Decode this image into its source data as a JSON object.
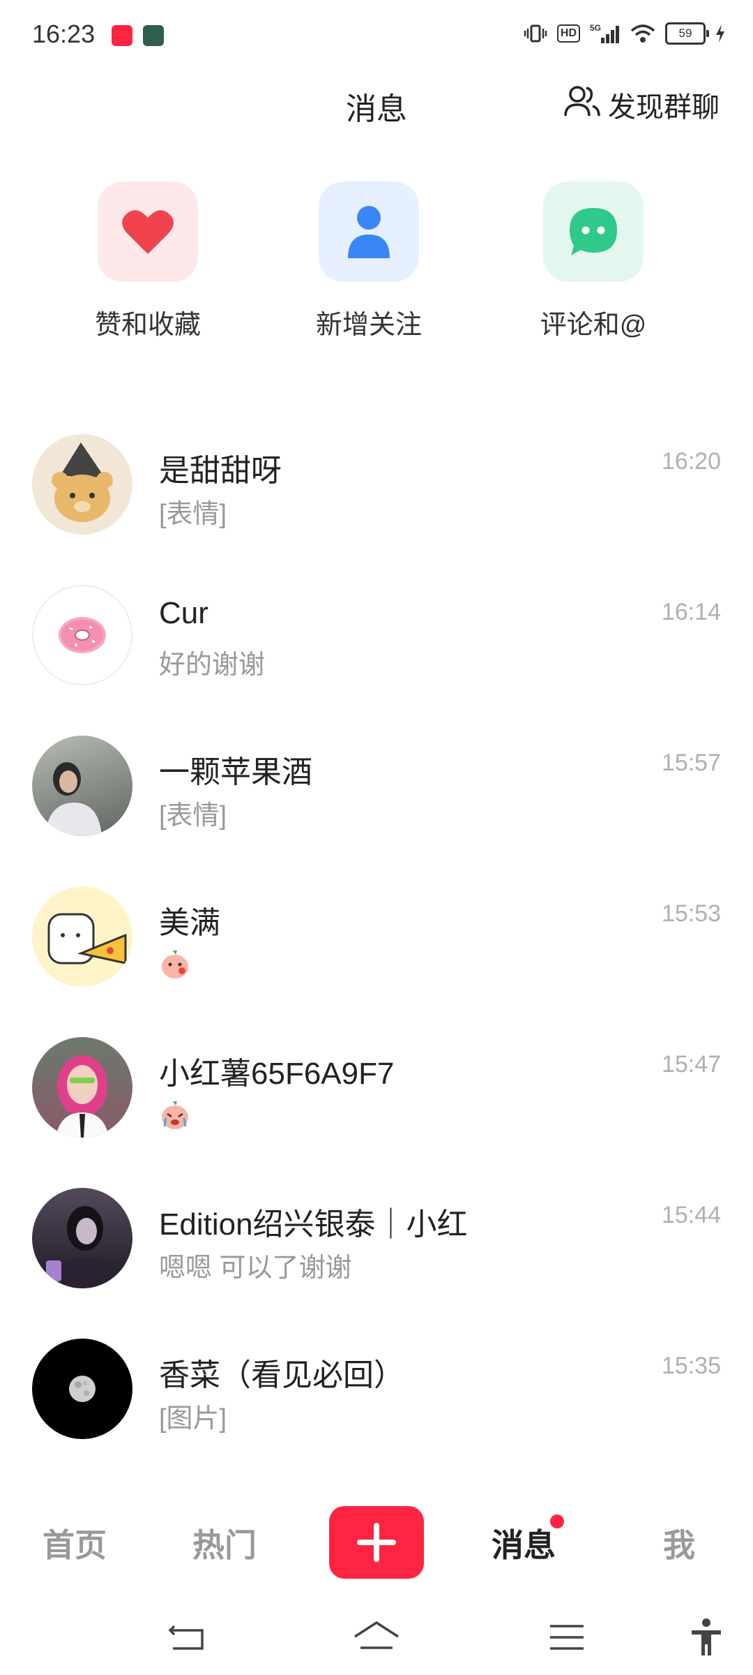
{
  "status_bar": {
    "time": "16:23",
    "network": "5G",
    "hd": "HD",
    "battery": "59"
  },
  "header": {
    "title": "消息",
    "group_chat_label": "发现群聊"
  },
  "quick_actions": [
    {
      "label": "赞和收藏",
      "icon": "heart-icon",
      "color": "#f0434e",
      "bg": "#fde9e9"
    },
    {
      "label": "新增关注",
      "icon": "person-icon",
      "color": "#3b86f5",
      "bg": "#e6f0ff"
    },
    {
      "label": "评论和@",
      "icon": "chat-bubble-icon",
      "color": "#2fc98b",
      "bg": "#e4f7ee"
    }
  ],
  "messages": [
    {
      "name": "是甜甜呀",
      "preview": "[表情]",
      "time": "16:20",
      "avatar_bg": "#f2e6d6"
    },
    {
      "name": "Cur",
      "preview": "好的谢谢",
      "time": "16:14",
      "avatar_bg": "#ffffff"
    },
    {
      "name": "一颗苹果酒",
      "preview": "[表情]",
      "time": "15:57",
      "avatar_bg": "#8a8f88"
    },
    {
      "name": "美满",
      "preview": "",
      "time": "15:53",
      "avatar_bg": "#fff4c9"
    },
    {
      "name": "小红薯65F6A9F7",
      "preview": "",
      "time": "15:47",
      "avatar_bg": "#8a5a6a"
    },
    {
      "name": "Edition绍兴银泰｜小红",
      "preview": "嗯嗯 可以了谢谢",
      "time": "15:44",
      "avatar_bg": "#3a3240"
    },
    {
      "name": "香菜（看见必回）",
      "preview": "[图片]",
      "time": "15:35",
      "avatar_bg": "#000000"
    }
  ],
  "tabs": {
    "home": "首页",
    "hot": "热门",
    "messages": "消息",
    "me": "我"
  },
  "colors": {
    "brand": "#ff2442"
  }
}
